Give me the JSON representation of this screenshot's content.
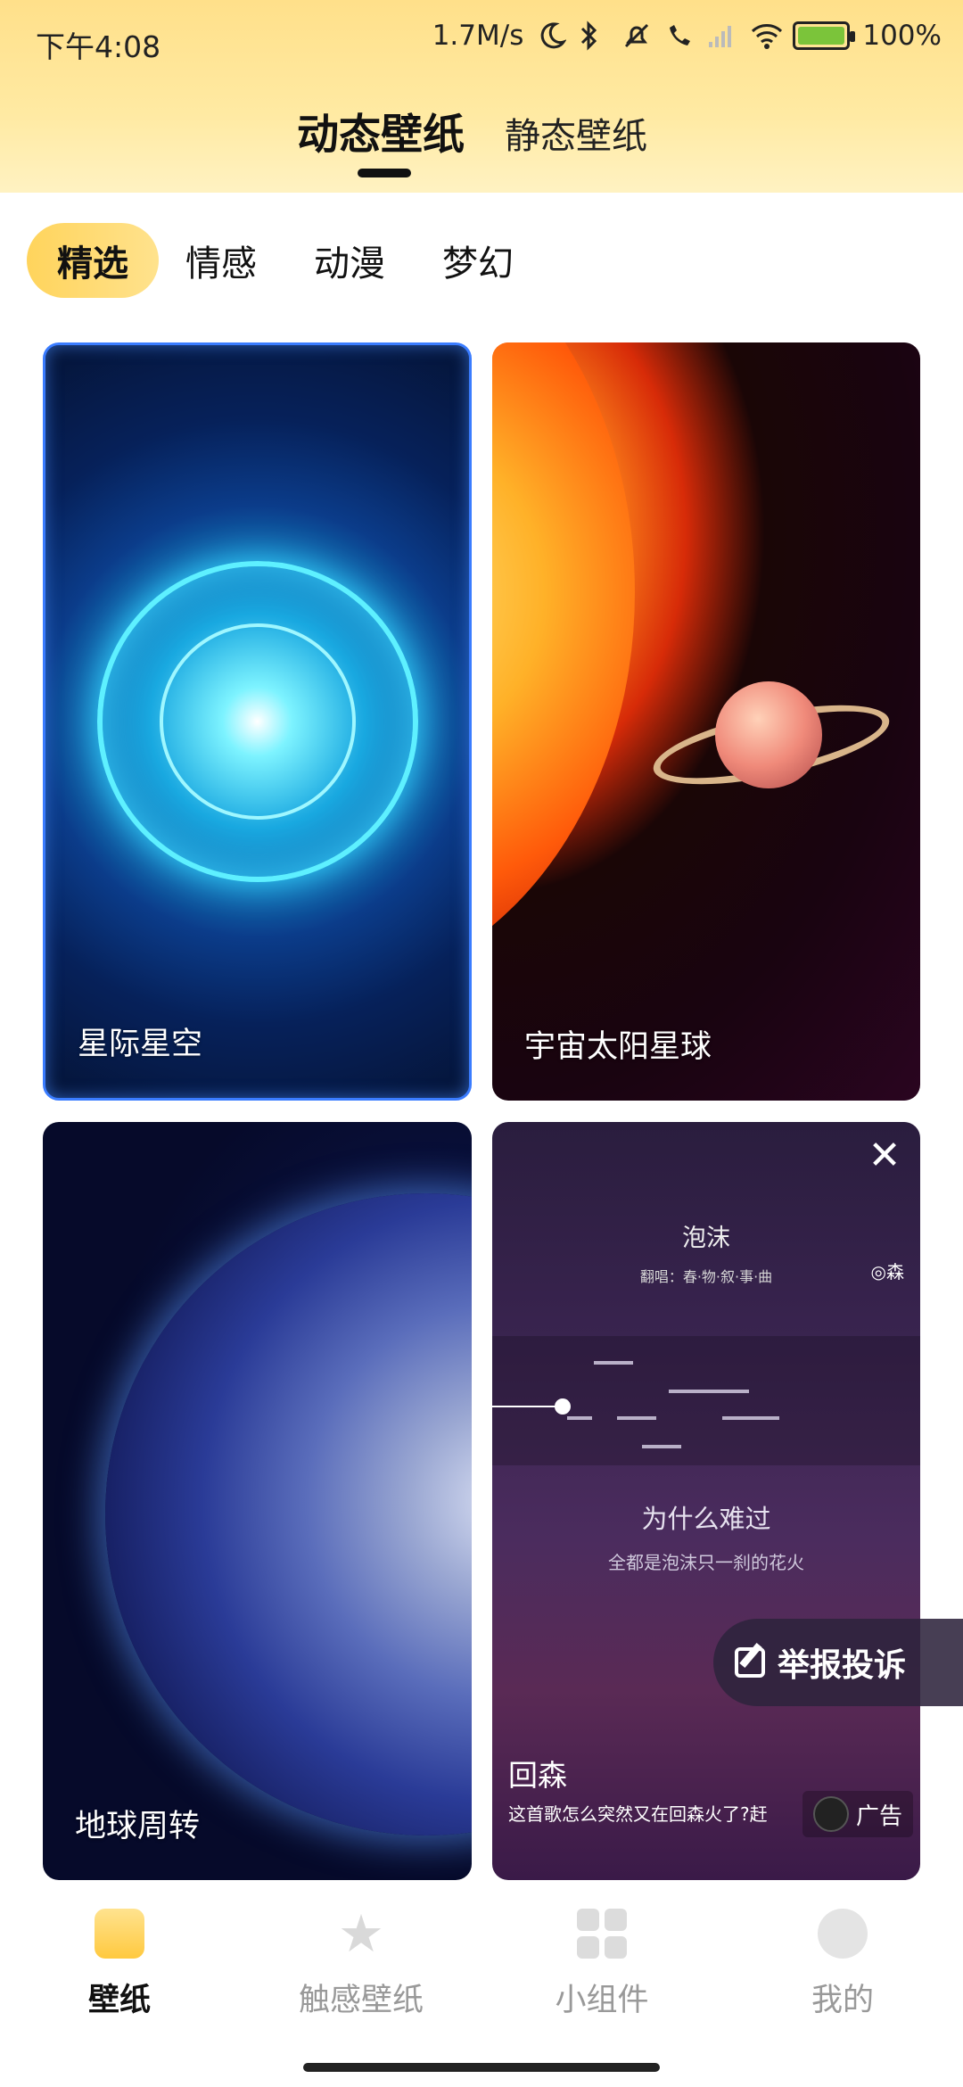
{
  "status_bar": {
    "time": "下午4:08",
    "speed": "1.7M/s",
    "battery": "100%"
  },
  "top_tabs": {
    "active": "动态壁纸",
    "inactive": "静态壁纸"
  },
  "categories": [
    "精选",
    "情感",
    "动漫",
    "梦幻"
  ],
  "cards": [
    {
      "label": "星际星空"
    },
    {
      "label": "宇宙太阳星球"
    },
    {
      "label": "地球周转"
    }
  ],
  "ad": {
    "song": "泡沫",
    "singer": "翻唱：春·物·叙·事·曲",
    "brand": "◎森",
    "question": "为什么难过",
    "lyric": "全都是泡沫只一刹的花火",
    "title": "回森",
    "desc": "这首歌怎么突然又在回森火了?赶",
    "badge": "广告",
    "close": "✕"
  },
  "report_button": "举报投诉",
  "bottom_nav": [
    {
      "label": "壁纸",
      "icon": "wallpaper-icon",
      "active": true
    },
    {
      "label": "触感壁纸",
      "icon": "star-icon",
      "active": false
    },
    {
      "label": "小组件",
      "icon": "widget-grid-icon",
      "active": false
    },
    {
      "label": "我的",
      "icon": "profile-face-icon",
      "active": false
    }
  ]
}
